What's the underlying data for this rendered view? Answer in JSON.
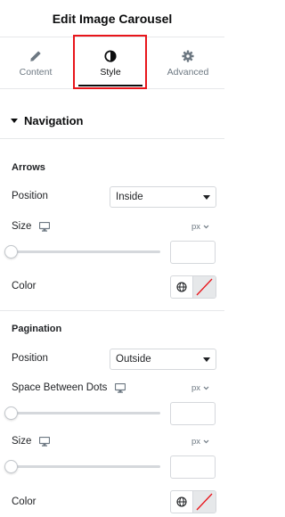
{
  "header": {
    "title": "Edit Image Carousel"
  },
  "tabs": [
    {
      "label": "Content",
      "icon": "pencil-icon"
    },
    {
      "label": "Style",
      "icon": "contrast-circle-icon",
      "active": true
    },
    {
      "label": "Advanced",
      "icon": "gear-icon"
    }
  ],
  "section": {
    "title": "Navigation",
    "expanded": true
  },
  "arrows": {
    "heading": "Arrows",
    "position": {
      "label": "Position",
      "value": "Inside"
    },
    "size": {
      "label": "Size",
      "unit": "px",
      "value": ""
    },
    "color": {
      "label": "Color"
    }
  },
  "pagination": {
    "heading": "Pagination",
    "position": {
      "label": "Position",
      "value": "Outside"
    },
    "space_between_dots": {
      "label": "Space Between Dots",
      "unit": "px",
      "value": ""
    },
    "size": {
      "label": "Size",
      "unit": "px",
      "value": ""
    },
    "color": {
      "label": "Color"
    }
  },
  "colors": {
    "highlight": "#e8151b",
    "text": "#1f2124",
    "muted": "#6d7882",
    "border": "#d5d8dc",
    "swatch_unset": "#e6e8ea"
  }
}
